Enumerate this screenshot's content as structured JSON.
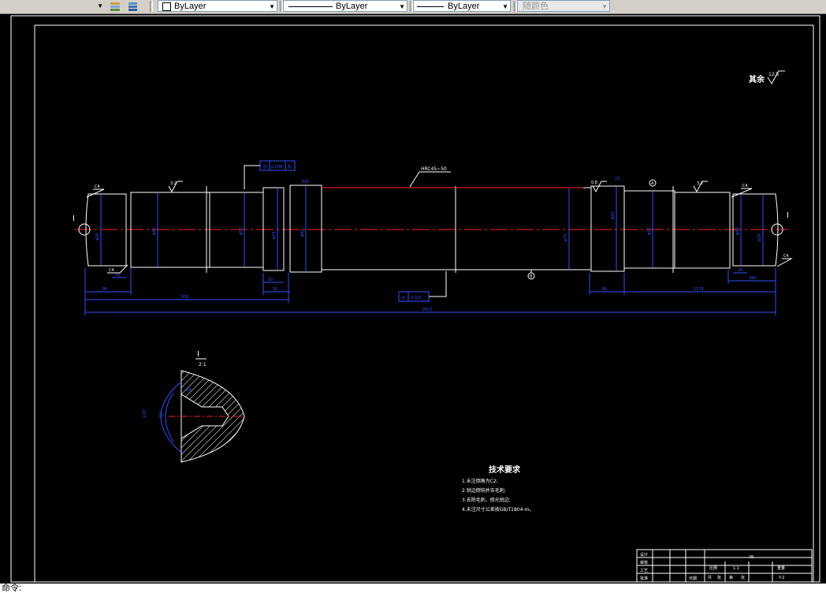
{
  "toolbar": {
    "layer_button_icons": [
      "layer-states-icon",
      "layer-previous-icon"
    ],
    "color_control": "ByLayer",
    "linetype_control": "ByLayer",
    "lineweight_control": "ByLayer",
    "plotstyle_control": "随颜色"
  },
  "drawing": {
    "roughness_note_label": "其余",
    "roughness_note_value": "12.5",
    "hardness": "HRC45~50",
    "section_label": "I",
    "section_scale": "2:1",
    "section_dims": [
      "R4",
      "60°",
      "120°"
    ],
    "datum_labels": [
      "A",
      "B"
    ],
    "chamfers": [
      "C4",
      "C4",
      "C4",
      "C4"
    ],
    "roughness_marks": [
      "3.2",
      "0.8",
      "0.8",
      "3.2"
    ],
    "tolerance_frame_1": [
      "◎",
      "0.008",
      "A"
    ],
    "tolerance_frame_2": [
      "↗",
      "0.025"
    ],
    "vert_diameters": [
      "φ30",
      "φ40",
      "φ50",
      "φ55",
      "φ60",
      "φ70",
      "φ60",
      "φ50",
      "φ40",
      "φ30"
    ],
    "horiz_dims": [
      "500",
      "2621",
      "80",
      "20",
      "50",
      "33",
      "200",
      "1170",
      "80",
      "30",
      "280",
      "22"
    ],
    "tech_title": "技术要求",
    "tech_lines": [
      "1.未注倒角为C2;",
      "2.锐边倒钝并去毛刺;",
      "3.去除毛刺，修光锐边;",
      "4.未注尺寸公差按GB/T1804-m。"
    ],
    "title_block": {
      "rows": [
        "设计",
        "审核",
        "工艺",
        "批准"
      ],
      "material": "45",
      "col_labels": [
        "比例",
        "1:1",
        "重量"
      ],
      "bottom": [
        "共",
        "张",
        "第",
        "张"
      ],
      "scale_label": "1:2",
      "sheet": "Y-2",
      "date_label": "日期"
    }
  },
  "command_line": "命令:"
}
